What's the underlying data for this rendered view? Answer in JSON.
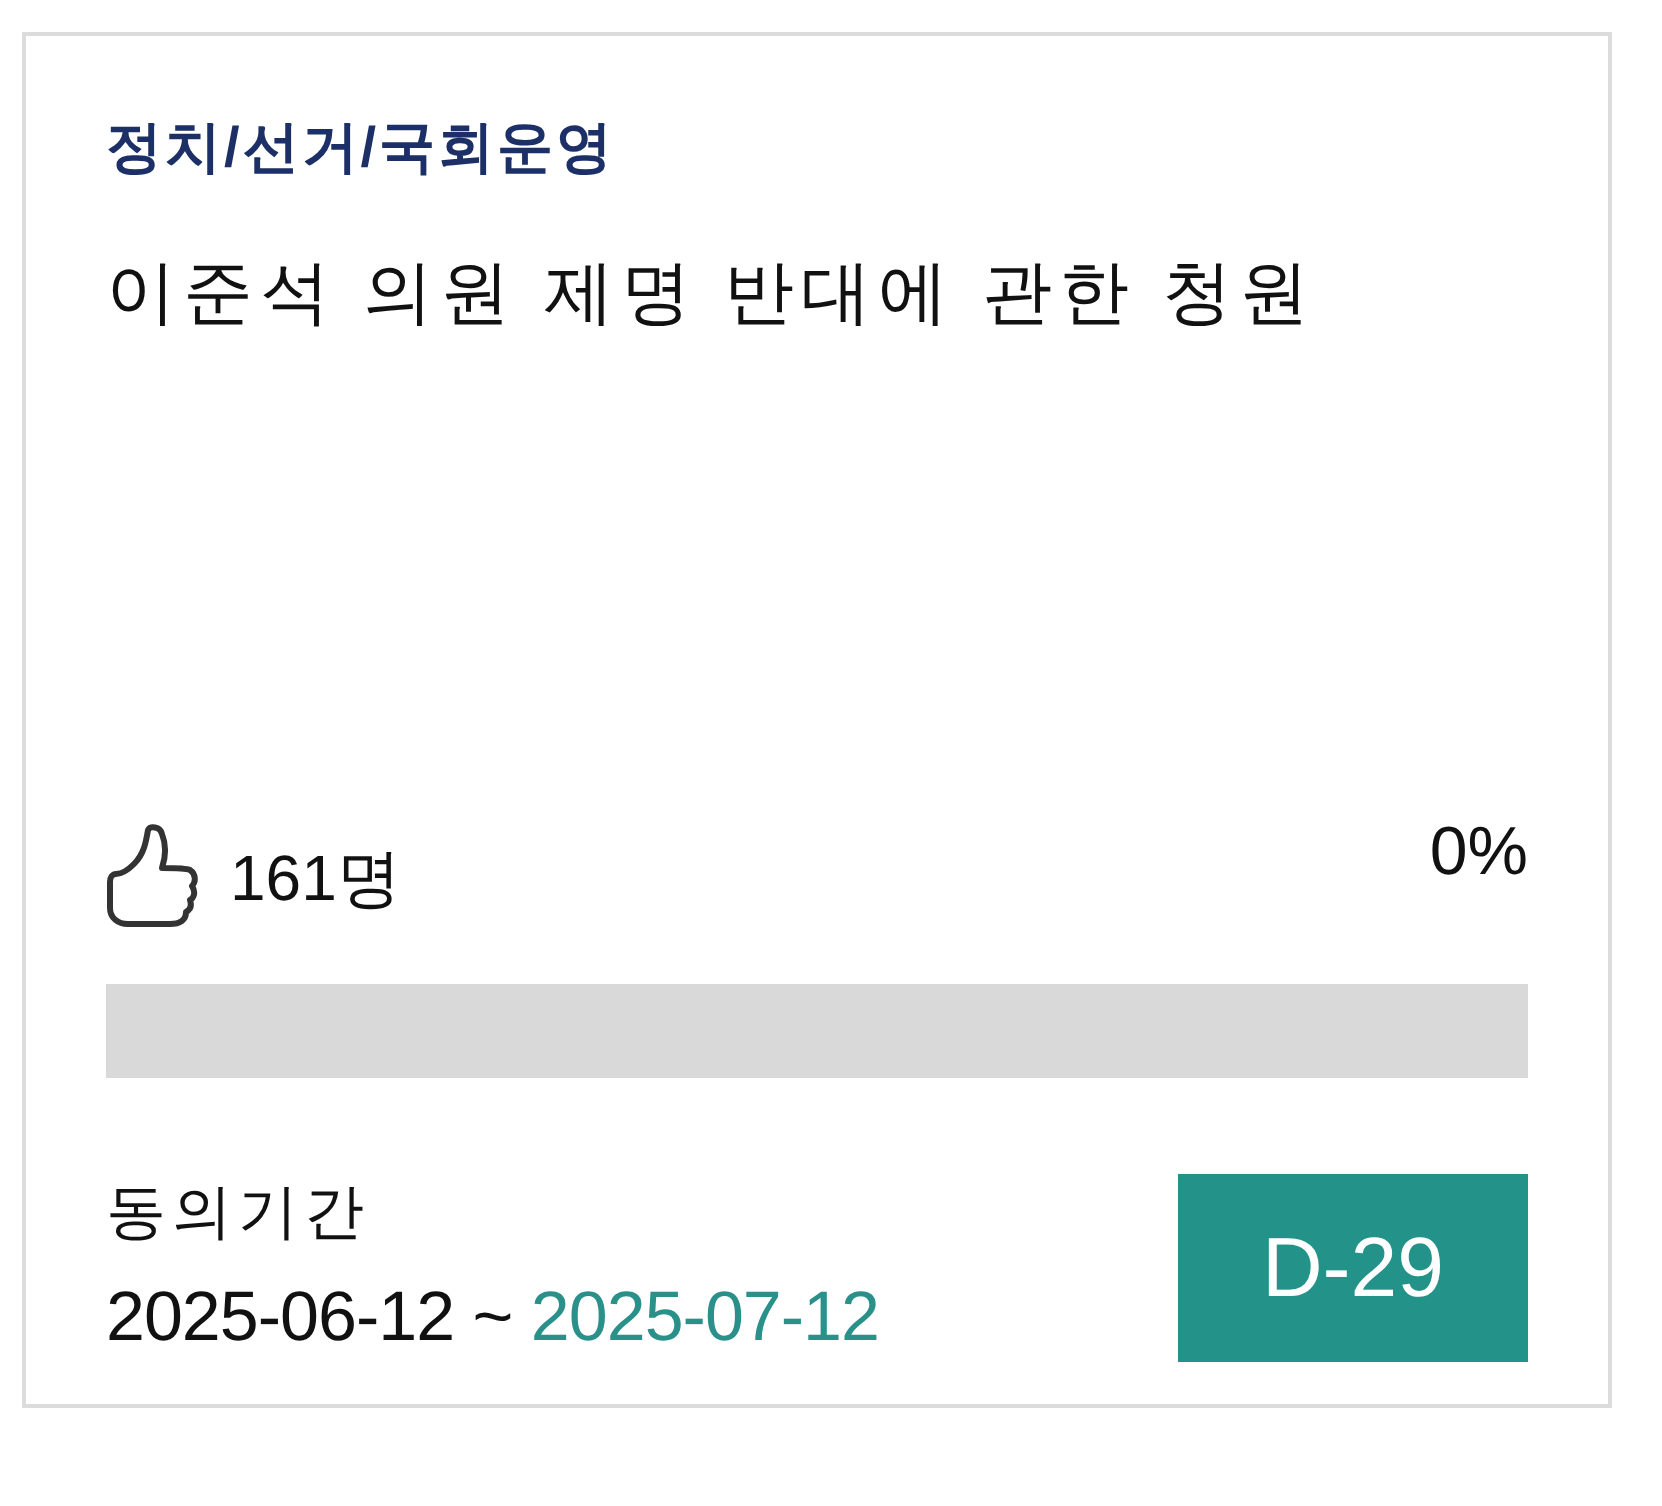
{
  "category": "정치/선거/국회운영",
  "title": "이준석 의원 제명 반대에 관한 청원",
  "support": {
    "count": "161명",
    "percent": "0%",
    "level": 0
  },
  "period": {
    "label": "동의기간",
    "start": "2025-06-12",
    "separator": "~",
    "end": "2025-07-12"
  },
  "badge": "D-29"
}
